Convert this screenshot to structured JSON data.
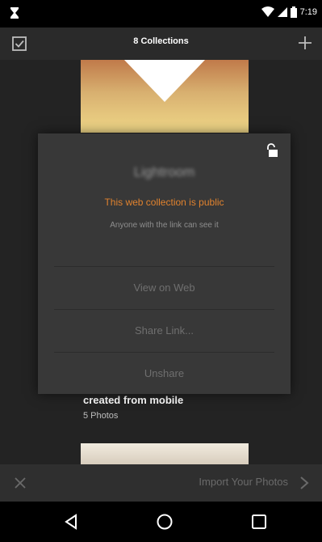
{
  "status_bar": {
    "time": "7:19",
    "icons": [
      "hourglass-icon",
      "wifi-icon",
      "cellular-signal-icon",
      "battery-icon"
    ]
  },
  "app_bar": {
    "title": "8 Collections",
    "icons": [
      "checkbox-select-icon",
      "add-icon"
    ]
  },
  "collection": {
    "name": "created from mobile",
    "count": "5 Photos"
  },
  "share_dialog": {
    "title": "Lightroom",
    "status": "This web collection is public",
    "description": "Anyone with the link can see it",
    "actions": {
      "view": "View on Web",
      "share": "Share Link...",
      "unshare": "Unshare"
    }
  },
  "import_bar": {
    "label": "Import Your Photos"
  },
  "colors": {
    "accent": "#e0822e",
    "background": "#232323",
    "dialog": "#383838"
  }
}
